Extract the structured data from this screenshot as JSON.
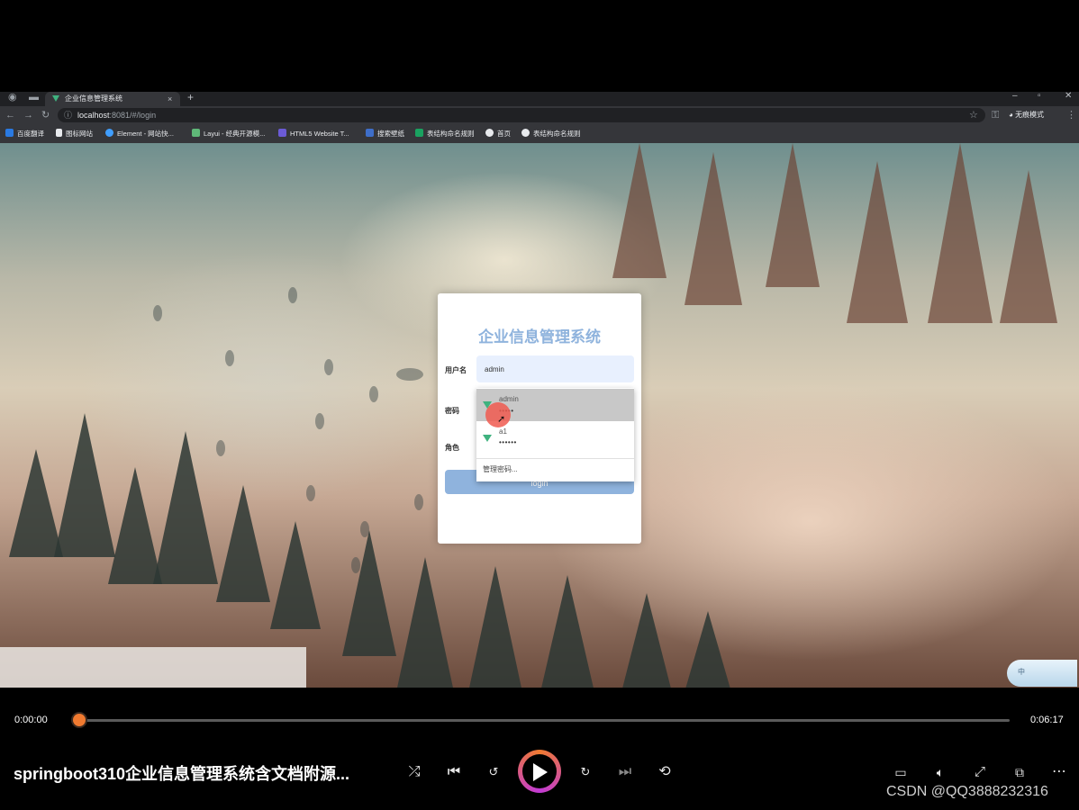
{
  "browser": {
    "tab_title": "企业信息管理系统",
    "tab_close": "×",
    "new_tab": "+",
    "url_host": "localhost",
    "url_path": ":8081/#/login",
    "incognito_label": "无痕模式",
    "bookmarks": [
      "百度翻译",
      "图标网站",
      "Element - 网站快...",
      "Layui - 经典开源模...",
      "HTML5 Website T...",
      "搜索壁纸",
      "表结构命名规则",
      "首页",
      "表结构命名规则"
    ]
  },
  "login": {
    "title": "企业信息管理系统",
    "username_label": "用户名",
    "username_value": "admin",
    "password_label": "密码",
    "role_label": "角色",
    "login_button": "login"
  },
  "autofill": {
    "items": [
      {
        "name": "admin",
        "password": "•••••"
      },
      {
        "name": "a1",
        "password": "••••••"
      }
    ],
    "manage": "管理密码..."
  },
  "ime": {
    "label": "中"
  },
  "player": {
    "current_time": "0:00:00",
    "total_time": "0:06:17",
    "progress": 0,
    "title": "springboot310企业信息管理系统含文档附源...",
    "watermark": "CSDN @QQ3888232316",
    "icons": [
      "shuffle-icon",
      "previous-icon",
      "rewind-10-icon",
      "play-icon",
      "forward-30-icon",
      "next-icon",
      "repeat-icon",
      "subtitles-icon",
      "volume-icon",
      "fullscreen-icon",
      "miniplayer-icon",
      "more-icon"
    ]
  }
}
